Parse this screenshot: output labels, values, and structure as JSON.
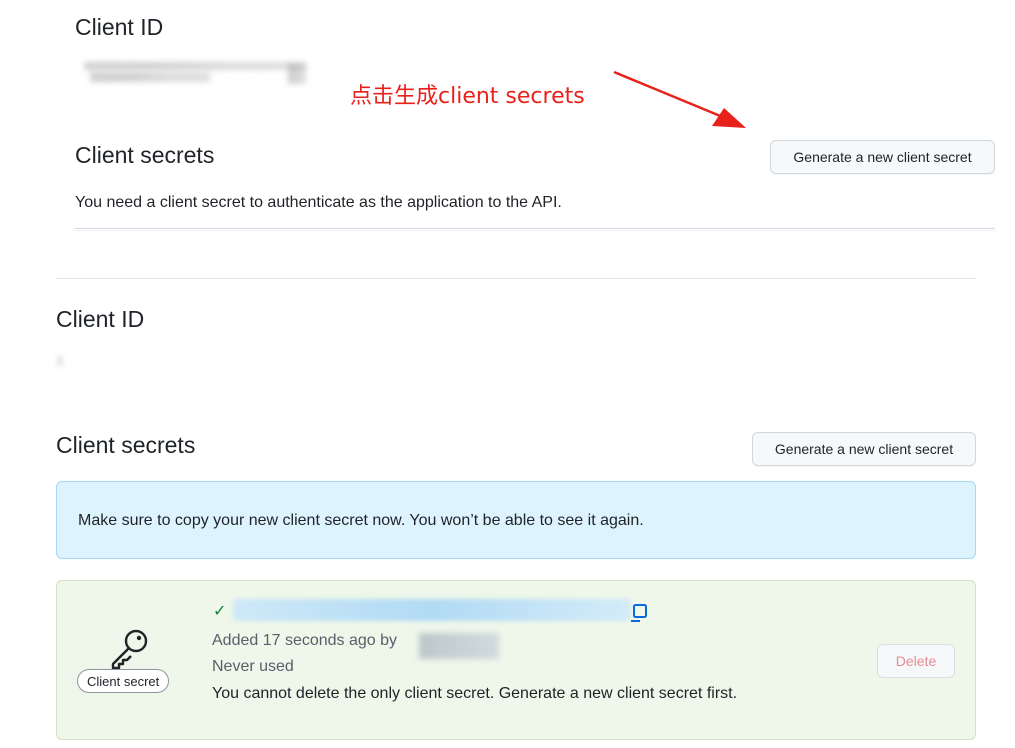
{
  "top": {
    "client_id_label": "Client ID",
    "annotation": "点击生成client secrets",
    "client_secrets_label": "Client secrets",
    "generate_button": "Generate a new client secret",
    "description": "You need a client secret to authenticate as the application to the API."
  },
  "bottom": {
    "client_id_label": "Client ID",
    "client_secrets_label": "Client secrets",
    "generate_button": "Generate a new client secret",
    "flash_message": "Make sure to copy your new client secret now. You won’t be able to see it again.",
    "secret": {
      "pill_label": "Client secret",
      "check_glyph": "✓",
      "added_text": "Added 17 seconds ago by",
      "usage_text": "Never used",
      "warning_text": "You cannot delete the only client secret. Generate a new client secret first.",
      "delete_button": "Delete"
    }
  },
  "colors": {
    "annotation_red": "#e8211b",
    "flash_bg": "#ddf4ff",
    "secret_bg": "#eef7ea",
    "success_green": "#1a7f37",
    "danger_disabled": "#e78b94"
  }
}
